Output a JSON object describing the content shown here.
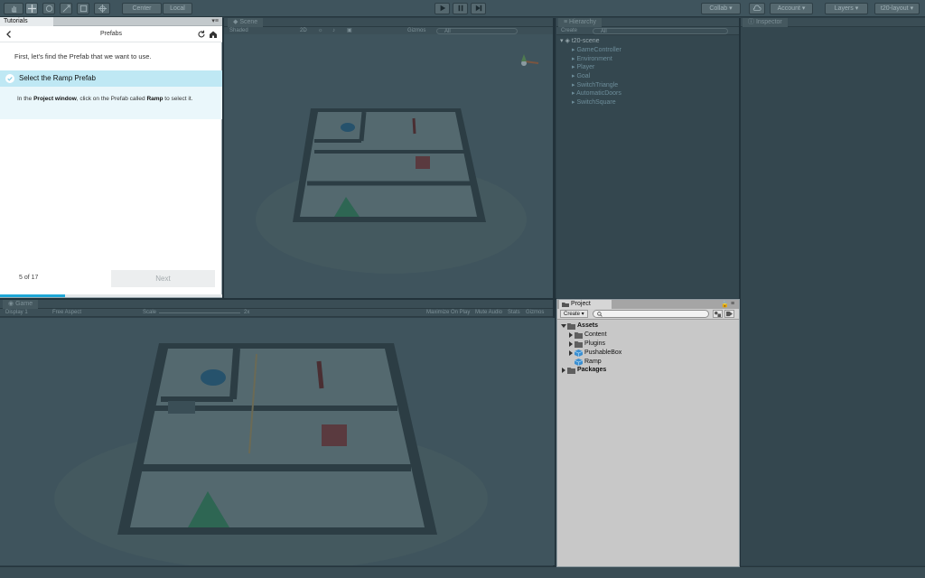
{
  "toolbar": {
    "pivot_label": "Center",
    "space_label": "Local",
    "collab_label": "Collab",
    "account_label": "Account",
    "layers_label": "Layers",
    "layout_label": "t20-layout"
  },
  "scene": {
    "tab_label": "Scene",
    "shading_mode": "Shaded",
    "gizmos_label": "Gizmos",
    "search_placeholder": "All"
  },
  "hierarchy": {
    "tab_label": "Hierarchy",
    "create_label": "Create",
    "search_placeholder": "All",
    "root": "t20-scene",
    "items": [
      "GameController",
      "Environment",
      "Player",
      "Goal",
      "SwitchTriangle",
      "AutomaticDoors",
      "SwitchSquare"
    ]
  },
  "inspector": {
    "tab_label": "Inspector"
  },
  "game": {
    "tab_label": "Game",
    "display_label": "Display 1",
    "aspect_label": "Free Aspect",
    "scale_label": "Scale",
    "scale_value": "2x",
    "maximize_label": "Maximize On Play",
    "mute_label": "Mute Audio",
    "stats_label": "Stats",
    "gizmos_label": "Gizmos"
  },
  "tutorial": {
    "tab_label": "Tutorials",
    "title": "Prefabs",
    "intro": "First, let's find the Prefab that we want to use.",
    "step_title": "Select the Ramp Prefab",
    "instruction_parts": [
      "In the ",
      "Project window",
      ", click on the Prefab called ",
      "Ramp",
      " to select it."
    ],
    "progress_text": "5 of 17",
    "progress_fraction": 0.294,
    "next_label": "Next",
    "accent_color": "#1ea7d6"
  },
  "project": {
    "tab_label": "Project",
    "create_label": "Create",
    "tree": [
      {
        "label": "Assets",
        "bold": true,
        "icon": "folder-icon"
      },
      {
        "label": "Content",
        "bold": false,
        "icon": "folder-icon"
      },
      {
        "label": "Plugins",
        "bold": false,
        "icon": "folder-icon"
      },
      {
        "label": "PushableBox",
        "bold": false,
        "icon": "prefab-icon"
      },
      {
        "label": "Ramp",
        "bold": false,
        "icon": "prefab-icon"
      },
      {
        "label": "Packages",
        "bold": true,
        "icon": "folder-icon"
      }
    ]
  }
}
